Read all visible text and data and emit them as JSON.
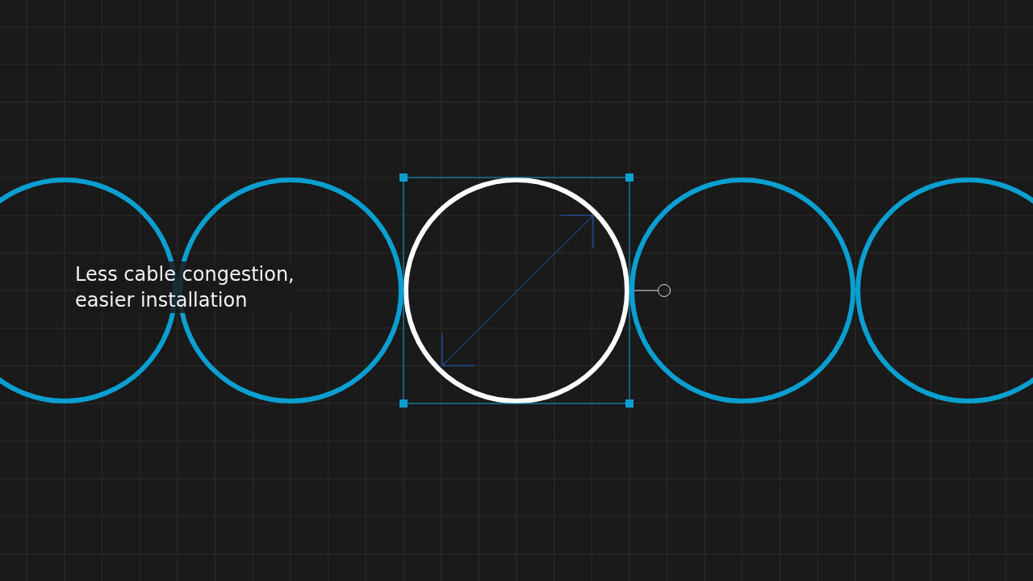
{
  "caption": {
    "lines": [
      "Less cable congestion,",
      "easier installation"
    ]
  },
  "circles": [
    {
      "selected": false
    },
    {
      "selected": false
    },
    {
      "selected": true
    },
    {
      "selected": false
    },
    {
      "selected": false
    }
  ]
}
